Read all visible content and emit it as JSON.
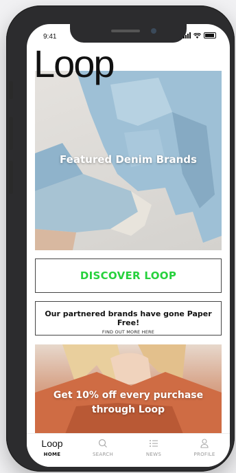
{
  "status_bar": {
    "time": "9:41"
  },
  "brand": {
    "logo": "Loop"
  },
  "hero": {
    "text": "Featured  Denim Brands"
  },
  "discover": {
    "label": "DISCOVER LOOP",
    "color": "#26d13c"
  },
  "paper_free": {
    "title": "Our partnered brands have gone Paper Free!",
    "link": "FIND OUT MORE HERE"
  },
  "promo": {
    "line1": "Get 10% off every purchase",
    "line2": "through Loop"
  },
  "tabs": [
    {
      "label": "HOME",
      "icon": "loop-logo-icon",
      "active": true
    },
    {
      "label": "SEARCH",
      "icon": "search-icon"
    },
    {
      "label": "NEWS",
      "icon": "list-icon"
    },
    {
      "label": "PROFILE",
      "icon": "user-icon"
    }
  ]
}
